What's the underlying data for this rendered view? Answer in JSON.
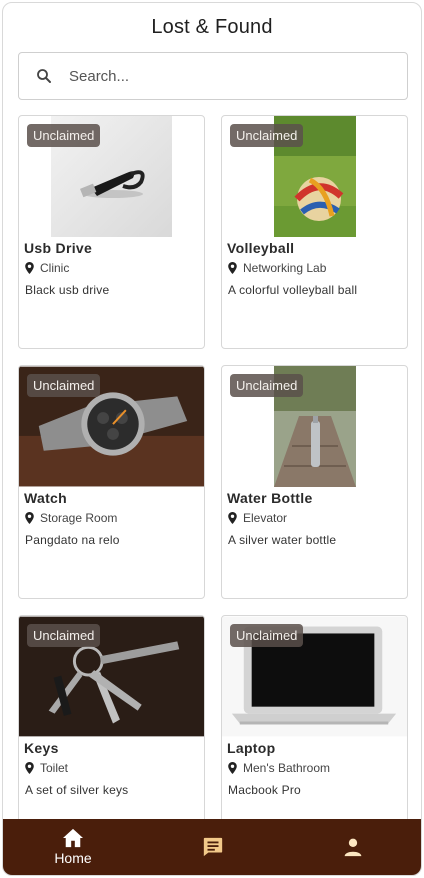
{
  "header": {
    "title": "Lost & Found"
  },
  "search": {
    "placeholder": "Search..."
  },
  "items": [
    {
      "status": "Unclaimed",
      "name": "Usb Drive",
      "location": "Clinic",
      "description": "Black usb drive"
    },
    {
      "status": "Unclaimed",
      "name": "Volleyball",
      "location": "Networking Lab",
      "description": "A colorful volleyball ball"
    },
    {
      "status": "Unclaimed",
      "name": "Watch",
      "location": "Storage Room",
      "description": "Pangdato na relo"
    },
    {
      "status": "Unclaimed",
      "name": "Water Bottle",
      "location": "Elevator",
      "description": "A silver water bottle"
    },
    {
      "status": "Unclaimed",
      "name": "Keys",
      "location": "Toilet",
      "description": "A set of silver keys"
    },
    {
      "status": "Unclaimed",
      "name": "Laptop",
      "location": "Men's Bathroom",
      "description": "Macbook Pro"
    }
  ],
  "bottom_nav": {
    "home_label": "Home",
    "icons": [
      "home-icon",
      "chat-icon",
      "person-icon"
    ],
    "active": "home"
  },
  "colors": {
    "nav_bg": "#4a1e0b",
    "chat_icon": "#f2c98a",
    "person_icon": "#fde7c2",
    "badge_bg": "#5a504b"
  }
}
